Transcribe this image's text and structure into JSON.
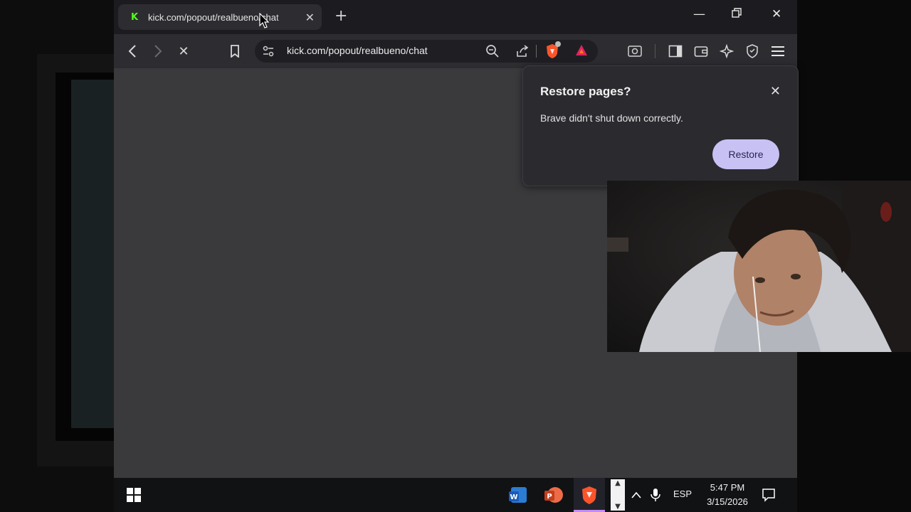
{
  "browser": {
    "tab": {
      "title": "kick.com/popout/realbueno/chat"
    },
    "address_bar": {
      "url": "kick.com/popout/realbueno/chat"
    }
  },
  "restore_popup": {
    "title": "Restore pages?",
    "message": "Brave didn't shut down correctly.",
    "restore_button": "Restore"
  },
  "taskbar": {
    "language": "ESP",
    "time": "5:47 PM",
    "date": "3/15/2026"
  },
  "colors": {
    "kick_green": "#53fc18",
    "restore_button_bg": "#c8c2f4",
    "brave_orange": "#fb542b"
  }
}
